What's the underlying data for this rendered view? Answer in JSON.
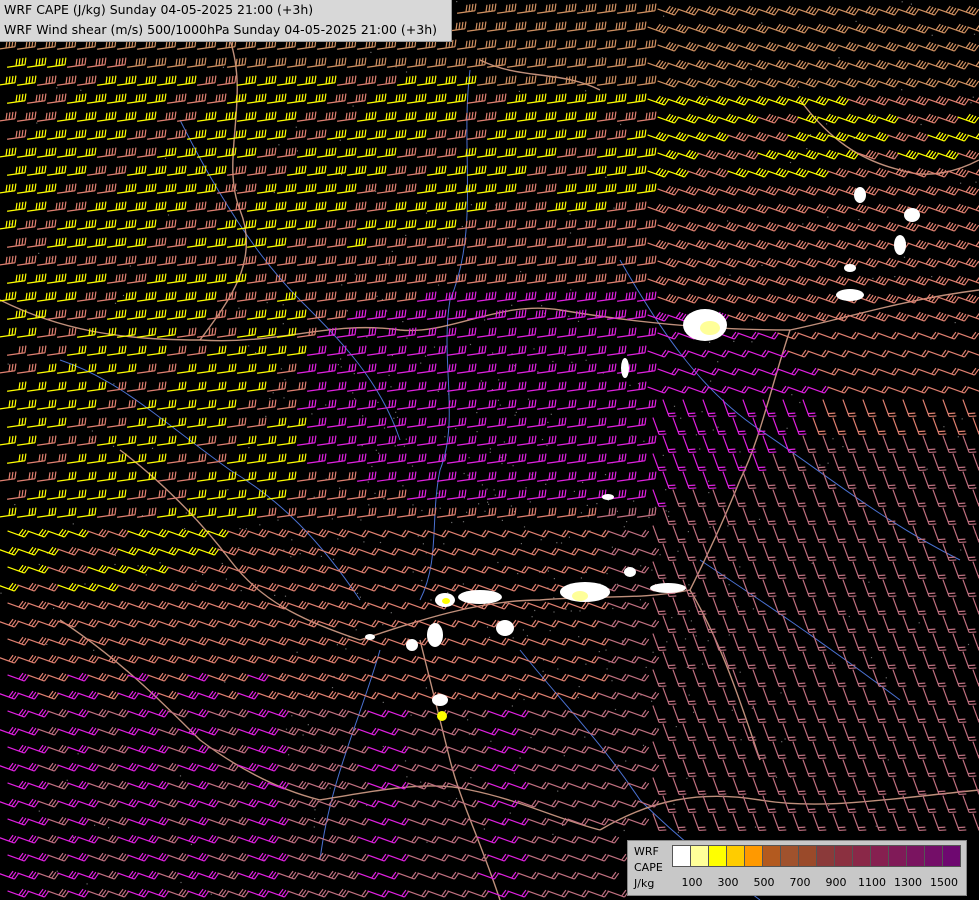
{
  "header": {
    "line1": "WRF CAPE (J/kg) Sunday 04-05-2025 21:00 (+3h)",
    "line2": "WRF Wind shear (m/s) 500/1000hPa Sunday 04-05-2025 21:00 (+3h)"
  },
  "legend": {
    "model": "WRF",
    "field": "CAPE",
    "unit": "J/kg",
    "colors": [
      "#ffffff",
      "#ffff99",
      "#ffff00",
      "#ffcc00",
      "#ff9900",
      "#b35a1f",
      "#a0522d",
      "#9a4a2a",
      "#8b3a3a",
      "#8b3040",
      "#8a2848",
      "#862050",
      "#801a58",
      "#7a1460",
      "#740e68",
      "#6e0870"
    ],
    "tick_labels": [
      "100",
      "300",
      "500",
      "700",
      "900",
      "1100",
      "1300",
      "1500"
    ]
  },
  "colors": {
    "barb_yellow": "#ffff00",
    "barb_magenta": "#e020e0",
    "barb_salmon": "#e08070",
    "barb_tan": "#d09060",
    "barb_mauve": "#c07080",
    "border": "#e0a890",
    "river": "#4a70d0",
    "terrain": "#9a9a9a"
  }
}
